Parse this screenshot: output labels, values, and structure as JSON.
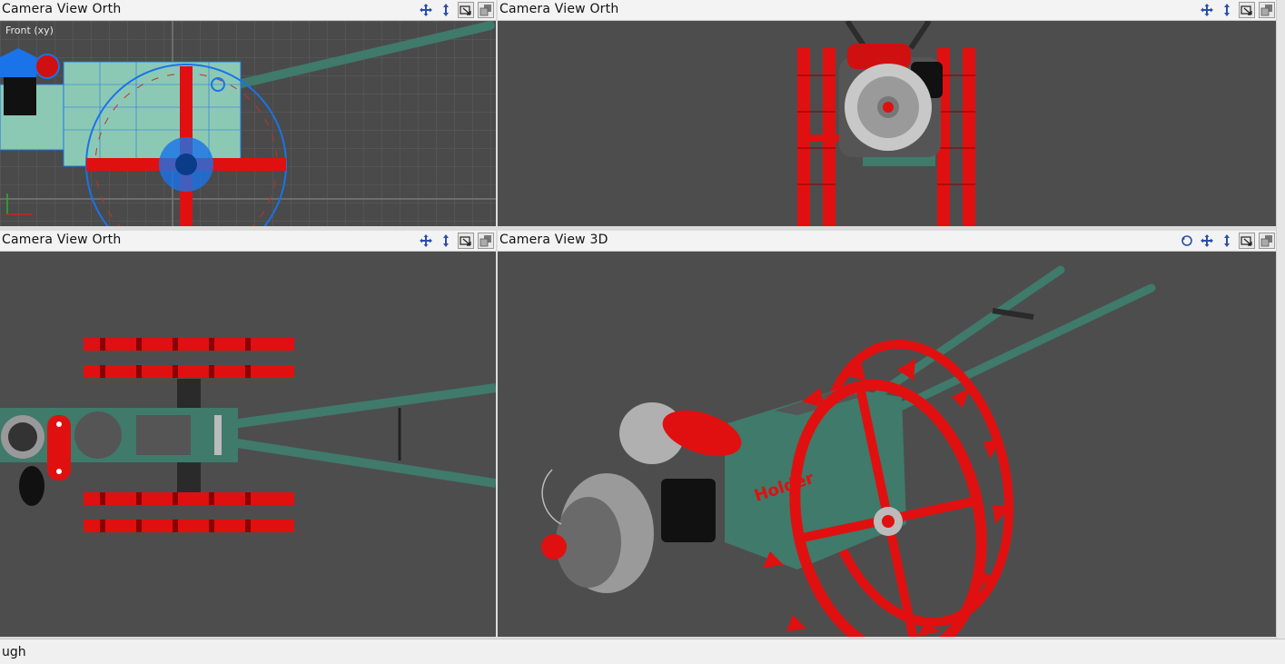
{
  "panes": {
    "top_left": {
      "title": "Camera  View  Orth",
      "view_label": "Front (xy)"
    },
    "top_right": {
      "title": "Camera  View  Orth"
    },
    "bottom_left": {
      "title": "Camera  View  Orth"
    },
    "bottom_right": {
      "title": "Camera  View  3D",
      "brand_text": "Holder"
    }
  },
  "tools": {
    "pan_icon": "move-arrows-icon",
    "dolly_icon": "vertical-arrows-icon",
    "camera_icon": "camera-pick-icon",
    "maximize_icon": "maximize-icon",
    "orbit_icon": "orbit-icon"
  },
  "status": {
    "text": "ugh"
  },
  "colors": {
    "viewport_bg": "#4d4d4d",
    "wheel_red": "#e01010",
    "body_green": "#3f7a6b",
    "selection_blue": "#1a73e8",
    "grid_line": "#5e5e5e"
  }
}
